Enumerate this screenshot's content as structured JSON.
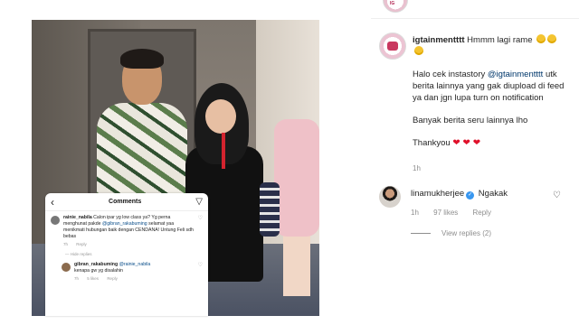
{
  "media": {
    "comments_overlay": {
      "back": "‹",
      "title": "Comments",
      "send": "▽",
      "comment1": {
        "user": "rainie_nabila",
        "text_a": " Calon ipar yg low class ya? Yg perna menghunat pakde ",
        "mention": "@gibran_rakabuming",
        "text_b": " selamat yaa menikmati hubungan baik dengan CENDANA! Untung  Feli sdh bebas",
        "time": "7h",
        "reply": "Reply"
      },
      "hide_replies": "— Hide replies",
      "comment2": {
        "user": "gibran_rakabuming",
        "mention": "@rainie_nabila",
        "text": "kenapa gw yg disalahin",
        "time": "7h",
        "likes": "5 likes",
        "reply": "Reply"
      }
    }
  },
  "panel": {
    "caption": {
      "user": "igtainmentttt",
      "line1": " Hmmm lagi rame",
      "p2_a": "Halo cek instastory ",
      "p2_mention": "@igtainmentttt",
      "p2_b": " utk berita lainnya yang gak diupload di feed ya dan jgn lupa turn on notification",
      "p3": "Banyak berita seru lainnya lho",
      "p4": "Thankyou",
      "hearts": "❤ ❤ ❤",
      "time": "1h"
    },
    "comment": {
      "user": "linamukherjee",
      "verified": "✓",
      "text": " Ngakak",
      "time": "1h",
      "likes": "97 likes",
      "reply": "Reply"
    },
    "view_replies": "View replies (2)"
  }
}
